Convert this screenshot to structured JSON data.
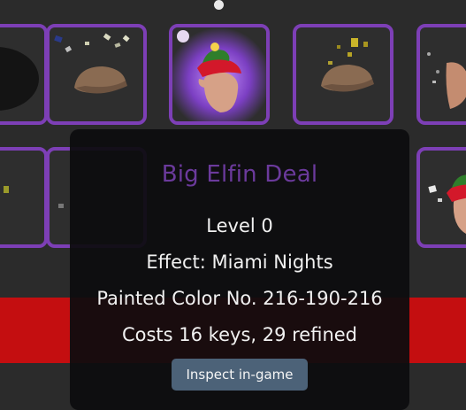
{
  "tooltip": {
    "title": "Big Elfin Deal",
    "level": "Level 0",
    "effect": "Effect: Miami Nights",
    "paint": "Painted Color No. 216-190-216",
    "cost": "Costs 16 keys, 29 refined",
    "inspect_button": "Inspect in-game"
  },
  "colors": {
    "slot_border": "#7d3fb6",
    "title": "#6b3a9c",
    "banner": "#c40e10",
    "button": "#4c6278"
  },
  "items": [
    {
      "icon": "dark-item-icon"
    },
    {
      "icon": "flat-cap-confetti-icon"
    },
    {
      "icon": "elfin-hat-character-icon"
    },
    {
      "icon": "flat-cap-gold-icon"
    },
    {
      "icon": "partial-character-icon"
    },
    {
      "icon": "partial-item-icon"
    },
    {
      "icon": "partial-item-icon"
    },
    {
      "icon": "elf-hat-character-icon"
    }
  ]
}
